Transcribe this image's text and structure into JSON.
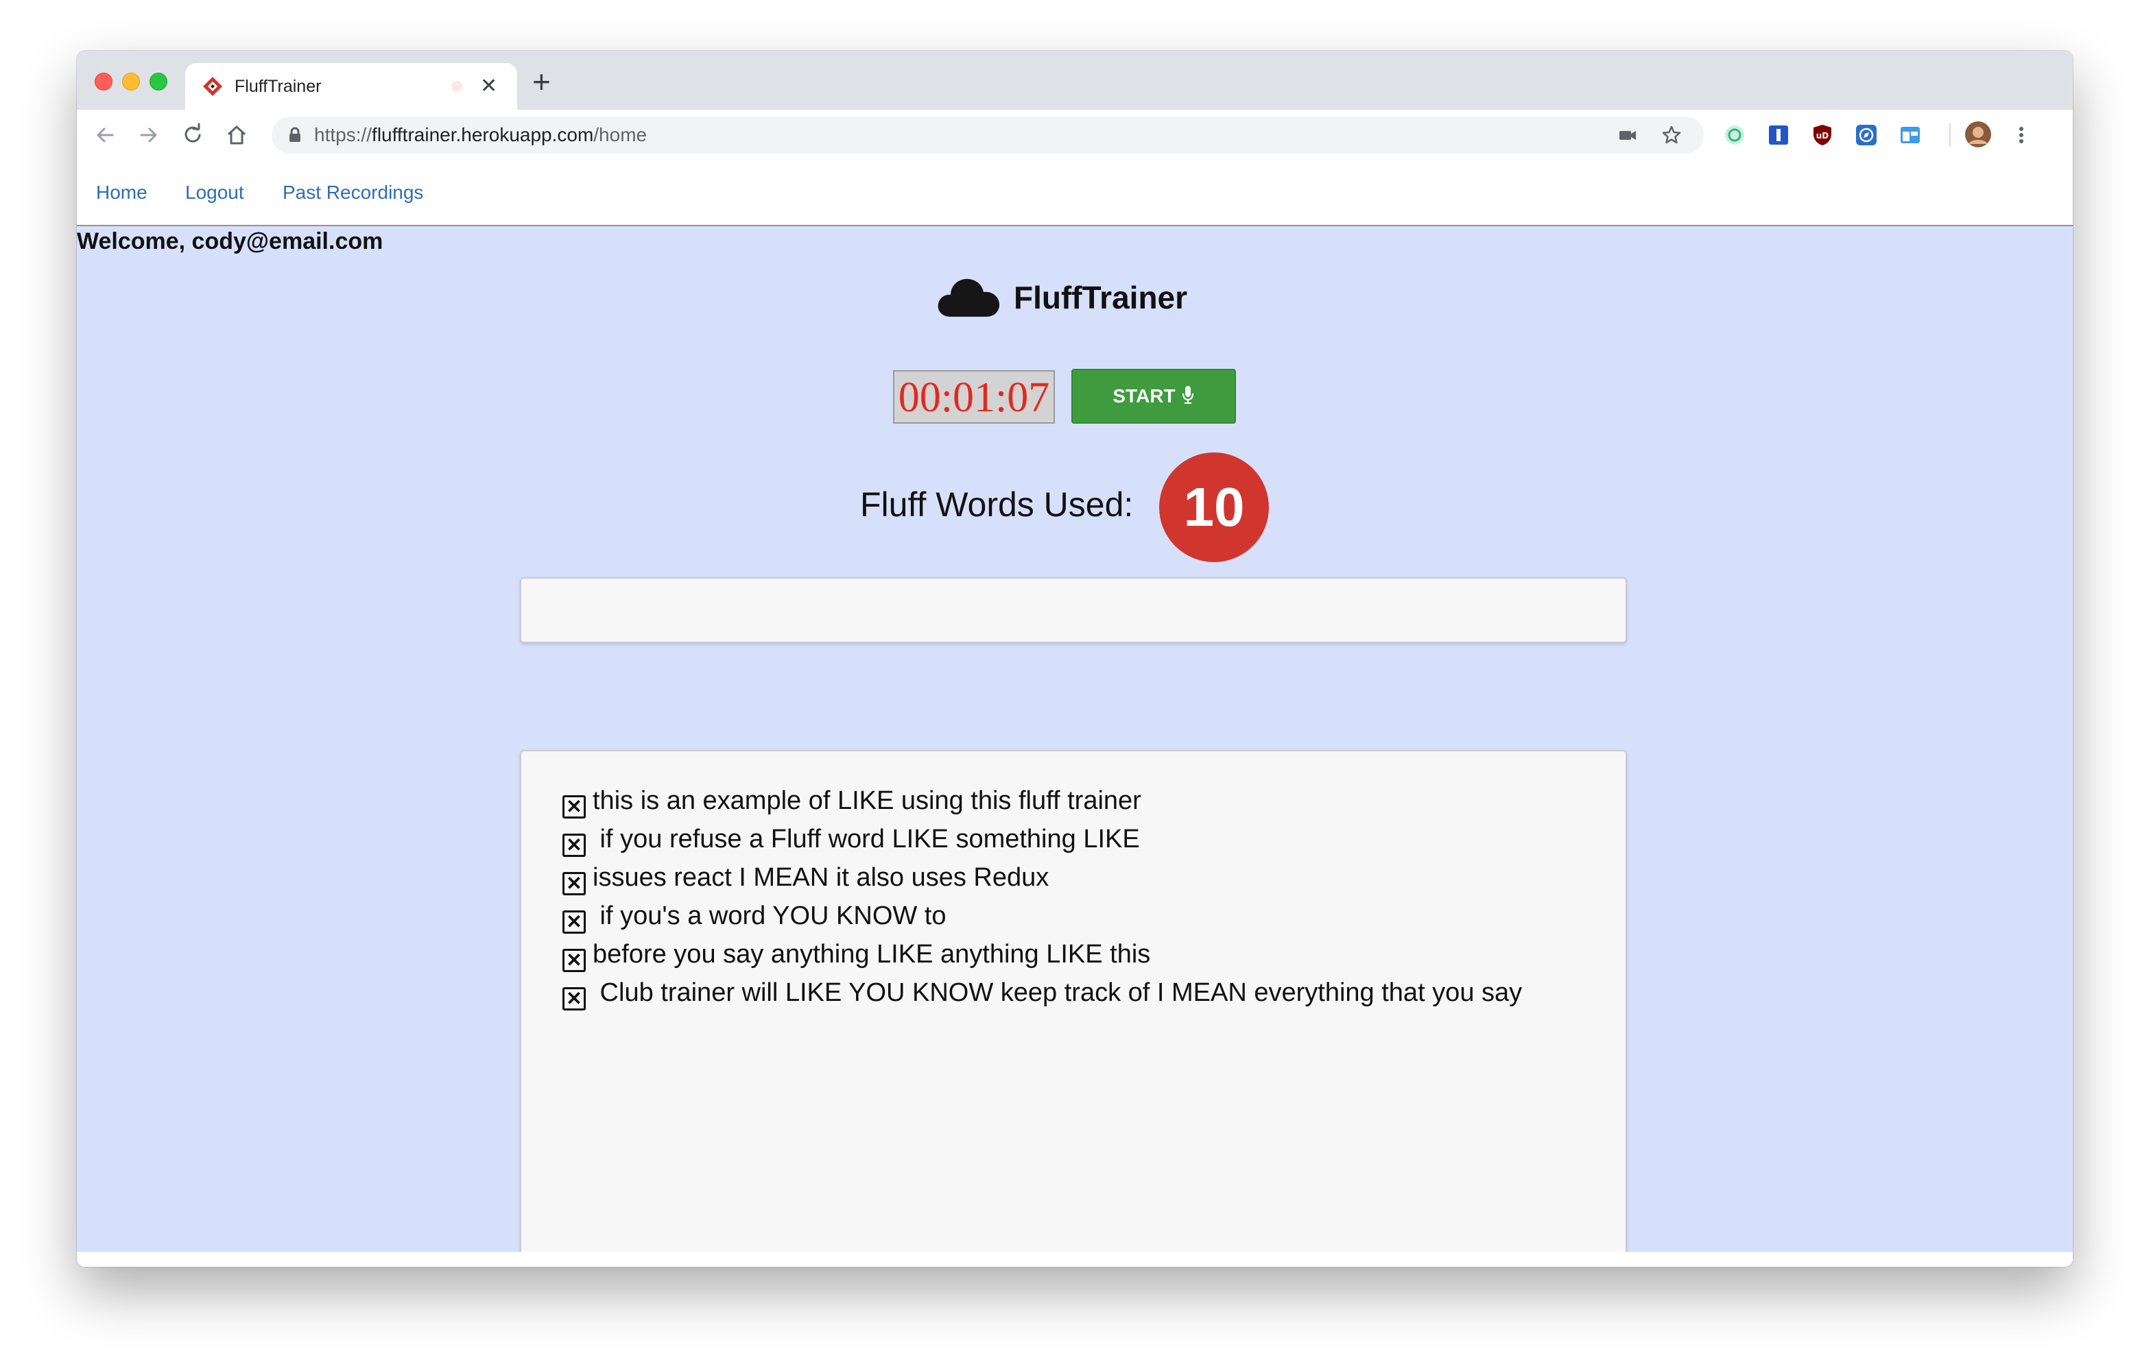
{
  "browser": {
    "tab_title": "FluffTrainer",
    "url_scheme": "https://",
    "url_host": "flufftrainer.herokuapp.com",
    "url_path": "/home",
    "tab_close_glyph": "✕",
    "new_tab_glyph": "+"
  },
  "nav": {
    "links": [
      "Home",
      "Logout",
      "Past Recordings"
    ]
  },
  "welcome": "Welcome, cody@email.com",
  "brand": "FluffTrainer",
  "timer": "00:01:07",
  "start_label": "START",
  "fluff_label": "Fluff Words Used:",
  "fluff_count": "10",
  "transcript_input_value": "",
  "transcript": [
    "this is an example of LIKE using this fluff trainer",
    " if you refuse a Fluff word LIKE something LIKE",
    "issues react I MEAN it also uses Redux",
    " if you's a word YOU KNOW to",
    "before you say anything LIKE anything LIKE this",
    " Club trainer will LIKE YOU KNOW keep track of I MEAN everything that you say"
  ],
  "colors": {
    "page_background": "#d6e0fb",
    "timer_text": "#e02b20",
    "start_button": "#3e9b3e",
    "badge": "#d0362e",
    "nav_link": "#2f6db0"
  },
  "icons": {
    "brand": "cloud-icon",
    "start": "microphone-icon",
    "transcript_item": "checkbox-x-icon"
  }
}
